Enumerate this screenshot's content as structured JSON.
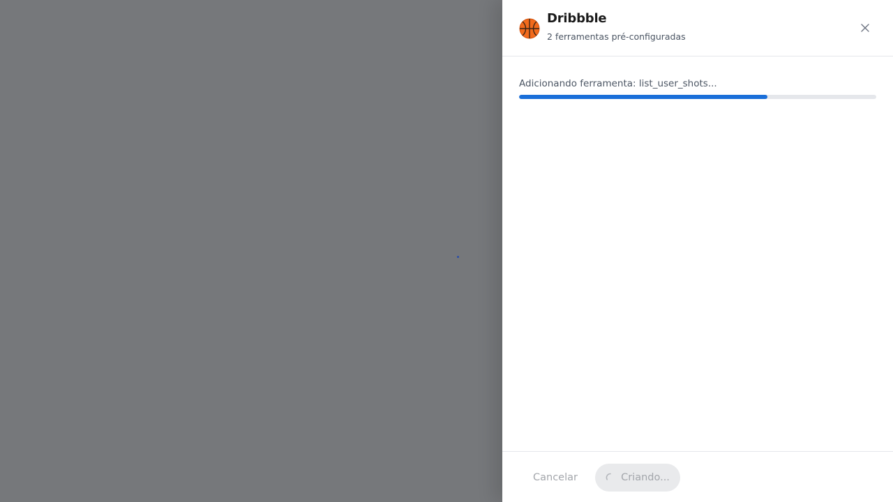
{
  "backdrop": {
    "color": "#76787b"
  },
  "drawer": {
    "header": {
      "icon": "basketball-icon",
      "title": "Dribbble",
      "subtitle": "2 ferramentas pré-configuradas",
      "close_icon": "close-icon"
    },
    "progress": {
      "label": "Adicionando ferramenta: list_user_shots...",
      "fraction": 0.695,
      "color": "#1a6fd9"
    },
    "footer": {
      "cancel_label": "Cancelar",
      "create_label": "Criando...",
      "create_icon": "spinner-icon"
    }
  }
}
